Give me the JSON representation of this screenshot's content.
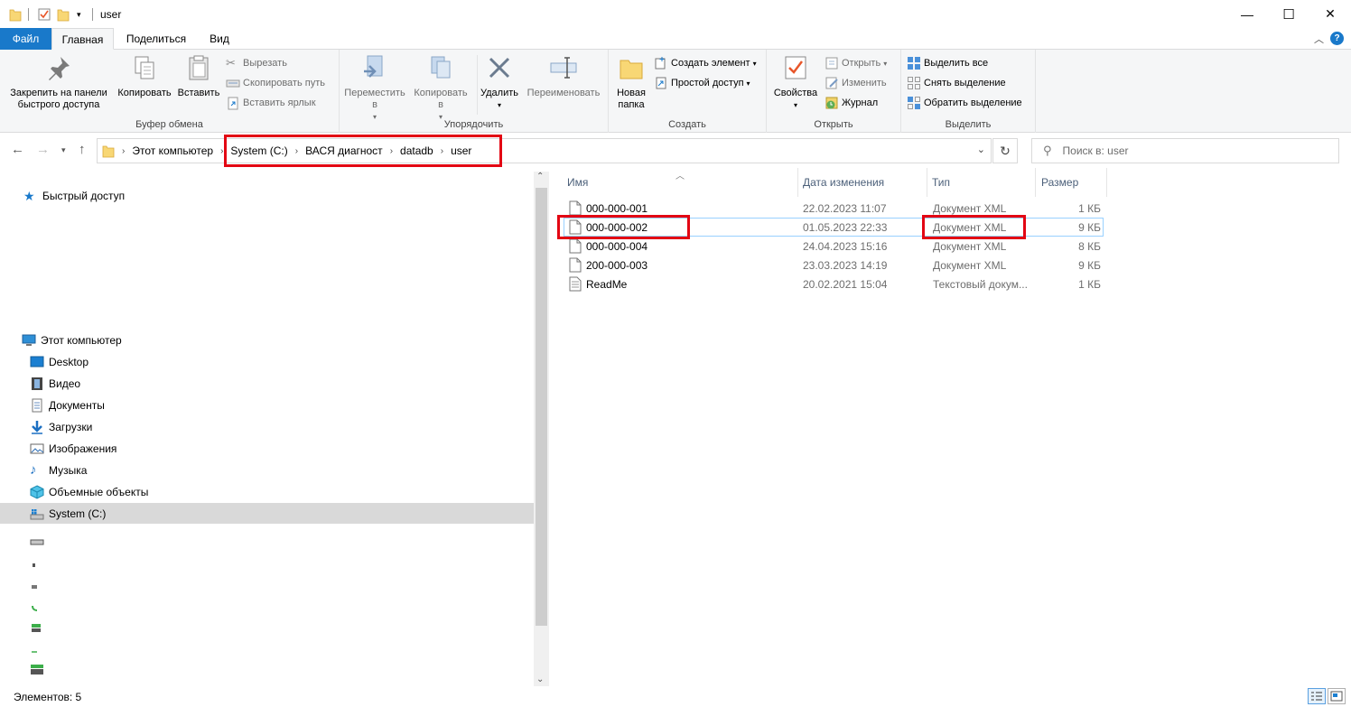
{
  "window": {
    "title": "user",
    "minimize_glyph": "—",
    "maximize_glyph": "☐",
    "close_glyph": "✕"
  },
  "ribbon_tabs": {
    "file": "Файл",
    "home": "Главная",
    "share": "Поделиться",
    "view": "Вид"
  },
  "ribbon": {
    "clipboard": {
      "label": "Буфер обмена",
      "pin": "Закрепить на панели быстрого доступа",
      "copy": "Копировать",
      "paste": "Вставить",
      "cut": "Вырезать",
      "copy_path": "Скопировать путь",
      "paste_shortcut": "Вставить ярлык"
    },
    "organize": {
      "label": "Упорядочить",
      "move_to": "Переместить в",
      "copy_to": "Копировать в",
      "delete": "Удалить",
      "rename": "Переименовать"
    },
    "new": {
      "label": "Создать",
      "new_folder": "Новая папка",
      "new_item": "Создать элемент",
      "easy_access": "Простой доступ"
    },
    "open": {
      "label": "Открыть",
      "properties": "Свойства",
      "open": "Открыть",
      "edit": "Изменить",
      "history": "Журнал"
    },
    "select": {
      "label": "Выделить",
      "select_all": "Выделить все",
      "select_none": "Снять выделение",
      "invert": "Обратить выделение"
    }
  },
  "address": {
    "root": "Этот компьютер",
    "crumbs": [
      "System (C:)",
      "ВАСЯ диагност",
      "datadb",
      "user"
    ],
    "search_placeholder": "Поиск в: user"
  },
  "nav_pane": {
    "quick_access": "Быстрый доступ",
    "this_pc": "Этот компьютер",
    "items": [
      "Desktop",
      "Видео",
      "Документы",
      "Загрузки",
      "Изображения",
      "Музыка",
      "Объемные объекты",
      "System (C:)"
    ]
  },
  "file_list": {
    "columns": {
      "name": "Имя",
      "modified": "Дата изменения",
      "type": "Тип",
      "size": "Размер"
    },
    "rows": [
      {
        "name": "000-000-001",
        "modified": "22.02.2023 11:07",
        "type": "Документ XML",
        "size": "1 КБ"
      },
      {
        "name": "000-000-002",
        "modified": "01.05.2023 22:33",
        "type": "Документ XML",
        "size": "9 КБ"
      },
      {
        "name": "000-000-004",
        "modified": "24.04.2023 15:16",
        "type": "Документ XML",
        "size": "8 КБ"
      },
      {
        "name": "200-000-003",
        "modified": "23.03.2023 14:19",
        "type": "Документ XML",
        "size": "9 КБ"
      },
      {
        "name": "ReadMe",
        "modified": "20.02.2021 15:04",
        "type": "Текстовый докум...",
        "size": "1 КБ"
      }
    ]
  },
  "status": {
    "items_count": "Элементов: 5"
  },
  "colors": {
    "accent": "#1979ca",
    "highlight_box": "#e30613",
    "folder": "#f8d775"
  }
}
